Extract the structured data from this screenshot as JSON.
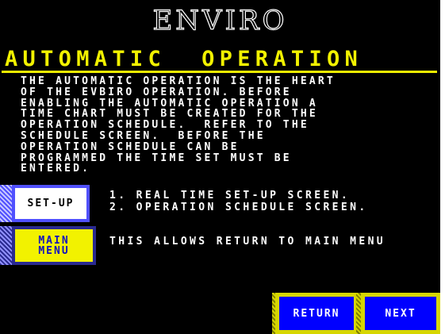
{
  "brand": "ENVIRO",
  "heading": "AUTOMATIC  OPERATION",
  "description_lines": [
    "THE AUTOMATIC OPERATION IS THE HEART",
    "OF THE EVBIRO OPERATION. BEFORE",
    "ENABLING THE AUTOMATIC OPERATION A",
    "TIME CHART MUST BE CREATED FOR THE",
    "OPERATION SCHEDULE.  REFER TO THE",
    "SCHEDULE SCREEN.  BEFORE THE",
    "OPERATION SCHEDULE CAN BE",
    "PROGRAMMED THE TIME SET MUST BE",
    "ENTERED."
  ],
  "setup": {
    "label": "SET-UP",
    "option_1": "1. REAL TIME SET-UP SCREEN.",
    "option_2": "2. OPERATION SCHEDULE SCREEN."
  },
  "main_menu": {
    "label_line1": "MAIN",
    "label_line2": "MENU",
    "description": "THIS ALLOWS RETURN TO MAIN MENU"
  },
  "nav": {
    "return_label": "RETURN",
    "next_label": "NEXT"
  },
  "colors": {
    "background": "#000000",
    "heading": "#f2f200",
    "button_blue": "#0000ff",
    "button_yellow": "#f2f200"
  }
}
